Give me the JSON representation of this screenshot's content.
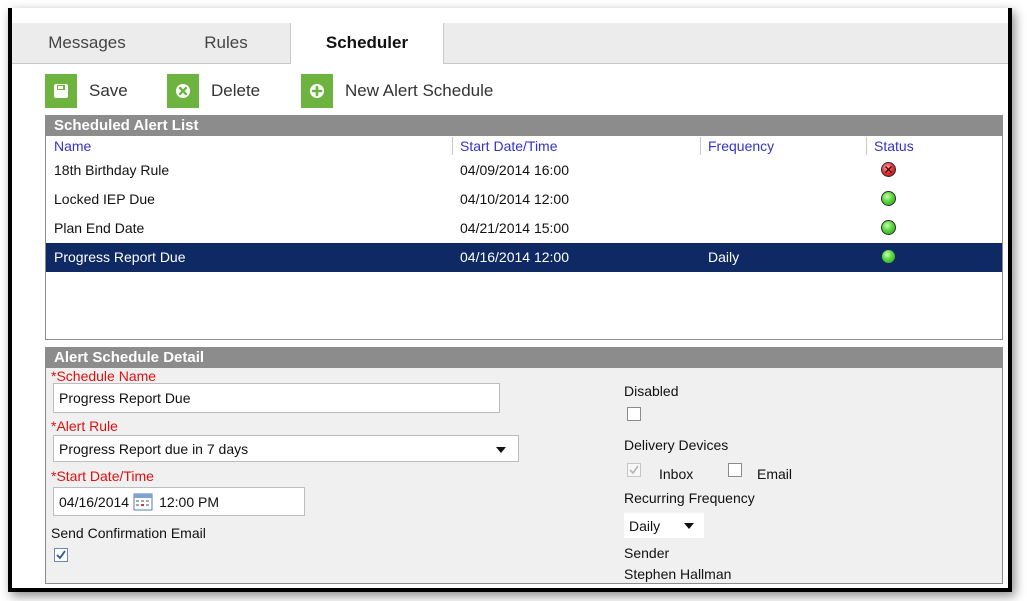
{
  "tabs": [
    {
      "label": "Messages",
      "active": false
    },
    {
      "label": "Rules",
      "active": false
    },
    {
      "label": "Scheduler",
      "active": true
    }
  ],
  "toolbar": {
    "save_label": "Save",
    "delete_label": "Delete",
    "new_label": "New Alert Schedule"
  },
  "list": {
    "title": "Scheduled Alert List",
    "columns": [
      "Name",
      "Start Date/Time",
      "Frequency",
      "Status"
    ],
    "rows": [
      {
        "name": "18th Birthday Rule",
        "start": "04/09/2014 16:00",
        "frequency": "",
        "status": "error"
      },
      {
        "name": "Locked IEP Due",
        "start": "04/10/2014 12:00",
        "frequency": "",
        "status": "active"
      },
      {
        "name": "Plan End Date",
        "start": "04/21/2014 15:00",
        "frequency": "",
        "status": "active"
      },
      {
        "name": "Progress Report Due",
        "start": "04/16/2014 12:00",
        "frequency": "Daily",
        "status": "active",
        "selected": true
      }
    ]
  },
  "detail": {
    "title": "Alert Schedule Detail",
    "schedule_name_label": "*Schedule Name",
    "schedule_name_value": "Progress Report Due",
    "alert_rule_label": "*Alert Rule",
    "alert_rule_value": "Progress Report due in 7 days",
    "start_label": "*Start Date/Time",
    "start_date_value": "04/16/2014",
    "start_time_value": "12:00 PM",
    "send_confirmation_label": "Send Confirmation Email",
    "send_confirmation_checked": true,
    "disabled_label": "Disabled",
    "disabled_checked": false,
    "delivery_devices_label": "Delivery Devices",
    "inbox_label": "Inbox",
    "inbox_checked": true,
    "email_label": "Email",
    "email_checked": false,
    "recurring_label": "Recurring Frequency",
    "recurring_value": "Daily",
    "sender_label": "Sender",
    "sender_value": "Stephen Hallman"
  },
  "colors": {
    "accent_green": "#6db33f",
    "selected_row": "#0e2963",
    "header_grey": "#8c8c8c",
    "required_red": "#e01010",
    "column_header_blue": "#3333cc"
  }
}
